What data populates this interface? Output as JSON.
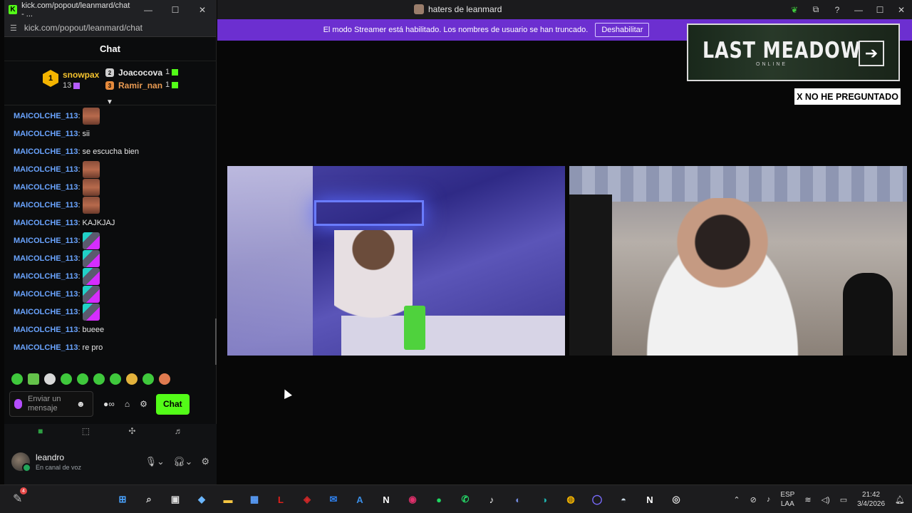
{
  "main_window": {
    "title": "haters de leanmard"
  },
  "banner": {
    "text": "El modo Streamer está habilitado. Los nombres de usuario se han truncado.",
    "button_label": "Deshabilitar"
  },
  "overlay": {
    "logo_text": "LAST MEADOW",
    "logo_subtitle": "ONLINE",
    "tag_text": "X NO HE PREGUNTADO"
  },
  "chat_window": {
    "title": "kick.com/popout/leanmard/chat - ...",
    "url": "kick.com/popout/leanmard/chat",
    "header": "Chat",
    "leaderboard": {
      "first": {
        "rank": "1",
        "name": "snowpax",
        "count": "13"
      },
      "second": {
        "name": "Joacocova",
        "count": "1"
      },
      "third": {
        "name": "Ramir_nan",
        "count": "1"
      }
    },
    "messages": [
      {
        "user": "MAICOLCHE_113",
        "text": "",
        "emote": "face"
      },
      {
        "user": "MAICOLCHE_113",
        "text": "sii",
        "emote": ""
      },
      {
        "user": "MAICOLCHE_113",
        "text": "se escucha bien",
        "emote": ""
      },
      {
        "user": "MAICOLCHE_113",
        "text": "",
        "emote": "face"
      },
      {
        "user": "MAICOLCHE_113",
        "text": "",
        "emote": "face"
      },
      {
        "user": "MAICOLCHE_113",
        "text": "",
        "emote": "face"
      },
      {
        "user": "MAICOLCHE_113",
        "text": "KAJKJAJ",
        "emote": ""
      },
      {
        "user": "MAICOLCHE_113",
        "text": "",
        "emote": "multi"
      },
      {
        "user": "MAICOLCHE_113",
        "text": "",
        "emote": "multi"
      },
      {
        "user": "MAICOLCHE_113",
        "text": "",
        "emote": "multi"
      },
      {
        "user": "MAICOLCHE_113",
        "text": "",
        "emote": "multi"
      },
      {
        "user": "MAICOLCHE_113",
        "text": "",
        "emote": "multi"
      },
      {
        "user": "MAICOLCHE_113",
        "text": "bueee",
        "emote": ""
      },
      {
        "user": "MAICOLCHE_113",
        "text": "re pro",
        "emote": ""
      }
    ],
    "input_placeholder": "Enviar un mensaje",
    "send_button": "Chat"
  },
  "discord": {
    "username": "leandro",
    "status": "En canal de voz"
  },
  "taskbar": {
    "notification_count": "4",
    "language_top": "ESP",
    "language_bottom": "LAA",
    "time": "21:42",
    "date": "3/4/2026",
    "apps": [
      {
        "name": "windows-start-icon",
        "glyph": "⊞",
        "color": "#4aa3ff"
      },
      {
        "name": "search-icon",
        "glyph": "⌕",
        "color": "#dddddd"
      },
      {
        "name": "task-view-icon",
        "glyph": "▣",
        "color": "#dddddd"
      },
      {
        "name": "copilot-icon",
        "glyph": "◆",
        "color": "#6bb6ff"
      },
      {
        "name": "file-explorer-icon",
        "glyph": "▬",
        "color": "#f5c542"
      },
      {
        "name": "store-icon",
        "glyph": "▦",
        "color": "#5aa0ff"
      },
      {
        "name": "app-l-icon",
        "glyph": "L",
        "color": "#e0201b"
      },
      {
        "name": "mcafee-icon",
        "glyph": "◈",
        "color": "#d62828"
      },
      {
        "name": "mail-icon",
        "glyph": "✉",
        "color": "#2f80ed"
      },
      {
        "name": "azure-icon",
        "glyph": "A",
        "color": "#3a8ee6"
      },
      {
        "name": "notion-n-icon",
        "glyph": "N",
        "color": "#ffffff"
      },
      {
        "name": "instagram-icon",
        "glyph": "◉",
        "color": "#e1306c"
      },
      {
        "name": "spotify-icon",
        "glyph": "●",
        "color": "#1ed760"
      },
      {
        "name": "whatsapp-icon",
        "glyph": "✆",
        "color": "#25d366"
      },
      {
        "name": "tiktok-icon",
        "glyph": "♪",
        "color": "#ffffff"
      },
      {
        "name": "discord-icon",
        "glyph": "◐",
        "color": "#7289da"
      },
      {
        "name": "edge-icon",
        "glyph": "◑",
        "color": "#1fb4b0"
      },
      {
        "name": "chrome-icon",
        "glyph": "◍",
        "color": "#f4b400"
      },
      {
        "name": "app-circle-icon",
        "glyph": "◯",
        "color": "#7a6cff"
      },
      {
        "name": "steam-icon",
        "glyph": "◓",
        "color": "#c7d5e0"
      },
      {
        "name": "notion-icon",
        "glyph": "N",
        "color": "#ffffff"
      },
      {
        "name": "obs-icon",
        "glyph": "◎",
        "color": "#dddddd"
      }
    ]
  }
}
